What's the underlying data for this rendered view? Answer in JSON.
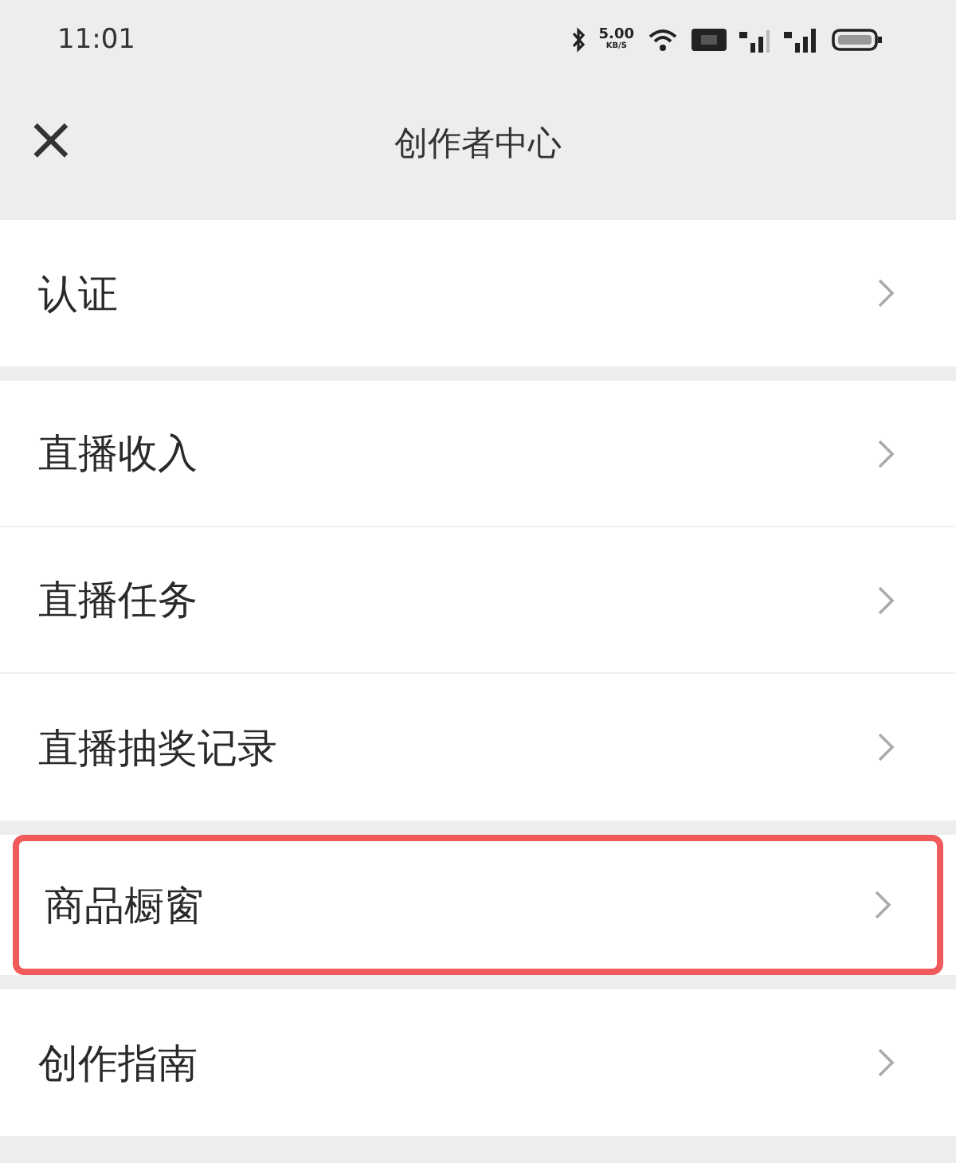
{
  "status_bar": {
    "time": "11:01",
    "net_speed": "5.00",
    "net_unit": "KB/S"
  },
  "nav_bar": {
    "close": "×",
    "title": "创作者中心"
  },
  "sections": [
    {
      "items": [
        {
          "label": "认证",
          "highlighted": false
        }
      ]
    },
    {
      "items": [
        {
          "label": "直播收入",
          "highlighted": false
        },
        {
          "label": "直播任务",
          "highlighted": false
        },
        {
          "label": "直播抽奖记录",
          "highlighted": false
        }
      ]
    },
    {
      "items": [
        {
          "label": "商品橱窗",
          "highlighted": true
        }
      ]
    },
    {
      "items": [
        {
          "label": "创作指南",
          "highlighted": false
        }
      ]
    }
  ]
}
